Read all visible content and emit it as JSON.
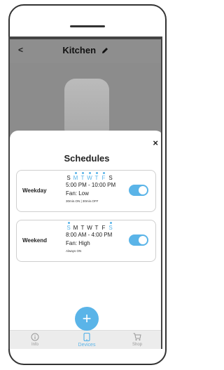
{
  "header": {
    "title": "Kitchen",
    "back_label": "<"
  },
  "sheet": {
    "title": "Schedules",
    "close_label": "×",
    "schedules": [
      {
        "name": "Weekday",
        "days": [
          "S",
          "M",
          "T",
          "W",
          "T",
          "F",
          "S"
        ],
        "active_days": [
          false,
          true,
          true,
          true,
          true,
          true,
          false
        ],
        "time": "5:00 PM - 10:00 PM",
        "fan": "Fan: Low",
        "note": "30min.ON | 30min.OFF",
        "enabled": true
      },
      {
        "name": "Weekend",
        "days": [
          "S",
          "M",
          "T",
          "W",
          "T",
          "F",
          "S"
        ],
        "active_days": [
          true,
          false,
          false,
          false,
          false,
          false,
          true
        ],
        "time": "8:00 AM - 4:00 PM",
        "fan": "Fan: High",
        "note": "Always ON",
        "enabled": true
      }
    ],
    "add_label": "+"
  },
  "nav": {
    "items": [
      {
        "label": "Info",
        "icon": "info-icon"
      },
      {
        "label": "Devices",
        "icon": "phone-icon",
        "active": true
      },
      {
        "label": "Shop",
        "icon": "cart-icon"
      }
    ]
  },
  "colors": {
    "accent": "#5ab4e8",
    "overlay": "#8c8c8c"
  }
}
